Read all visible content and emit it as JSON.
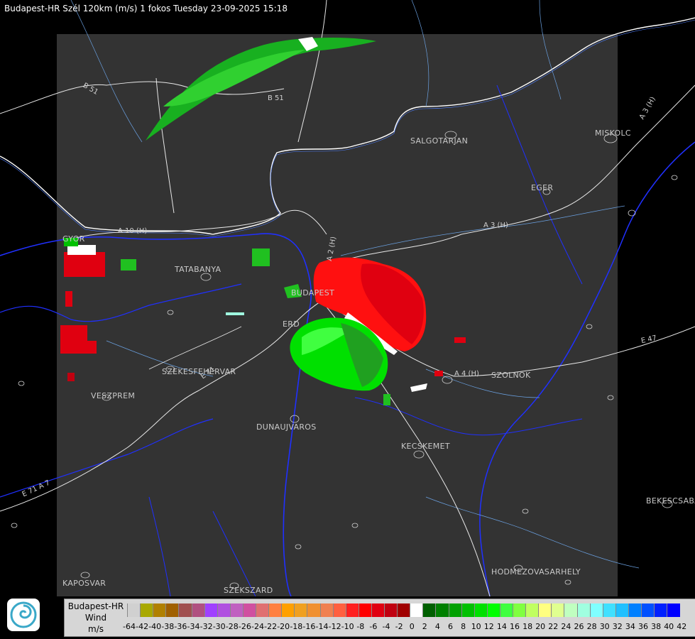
{
  "title": "Budapest-HR Szél 120km (m/s) 1 fokos Tuesday 23-09-2025 15:18",
  "cities": [
    {
      "name": "SALGOTARJAN"
    },
    {
      "name": "MISKOLC"
    },
    {
      "name": "EGER"
    },
    {
      "name": "TATABANYA"
    },
    {
      "name": "BUDAPEST"
    },
    {
      "name": "ERD"
    },
    {
      "name": "SZEKESFEHERVAR"
    },
    {
      "name": "VESZPREM"
    },
    {
      "name": "DUNAUJVAROS"
    },
    {
      "name": "KECSKEMET"
    },
    {
      "name": "SZOLNOK"
    },
    {
      "name": "BEKESCSABA"
    },
    {
      "name": "HODMEZOVASARHELY"
    },
    {
      "name": "KAPOSVAR"
    },
    {
      "name": "SZEKSZARD"
    },
    {
      "name": "GYOR"
    }
  ],
  "roads": [
    {
      "name": "B 51"
    },
    {
      "name": "B 51"
    },
    {
      "name": "A 3 (H)"
    },
    {
      "name": "A 3 (H)"
    },
    {
      "name": "A 10 (H)"
    },
    {
      "name": "A 2 (H)"
    },
    {
      "name": "A 4 (H)"
    },
    {
      "name": "E 47"
    },
    {
      "name": "E 71 A 7"
    },
    {
      "name": "E 71"
    }
  ],
  "legend": {
    "line1": "Budapest-HR",
    "line2": "Wind",
    "line3": "m/s",
    "ticks": [
      "-64",
      "-42",
      "-40",
      "-38",
      "-36",
      "-34",
      "-32",
      "-30",
      "-28",
      "-26",
      "-24",
      "-22",
      "-20",
      "-18",
      "-16",
      "-14",
      "-12",
      "-10",
      "-8",
      "-6",
      "-4",
      "-2",
      "0",
      "2",
      "4",
      "6",
      "8",
      "10",
      "12",
      "14",
      "16",
      "18",
      "20",
      "22",
      "24",
      "26",
      "28",
      "30",
      "32",
      "34",
      "36",
      "38",
      "40",
      "42"
    ],
    "colors": [
      "#d0d0d0",
      "#a8a800",
      "#b08000",
      "#a06000",
      "#a05050",
      "#b05080",
      "#a040ff",
      "#b050e0",
      "#c060c0",
      "#d050a0",
      "#e07070",
      "#ff8040",
      "#ffa000",
      "#f0a020",
      "#f09030",
      "#f08050",
      "#ff6040",
      "#ff2020",
      "#ff0000",
      "#e00010",
      "#c00010",
      "#a00000",
      "#ffffff",
      "#006000",
      "#008000",
      "#00a000",
      "#00c000",
      "#00e000",
      "#00ff00",
      "#40ff40",
      "#80ff40",
      "#c0ff60",
      "#ffff80",
      "#e0ff90",
      "#c0ffc0",
      "#a0ffe0",
      "#80ffff",
      "#40e0ff",
      "#20c0ff",
      "#0080ff",
      "#0050ff",
      "#0020ff",
      "#0000ff"
    ]
  }
}
